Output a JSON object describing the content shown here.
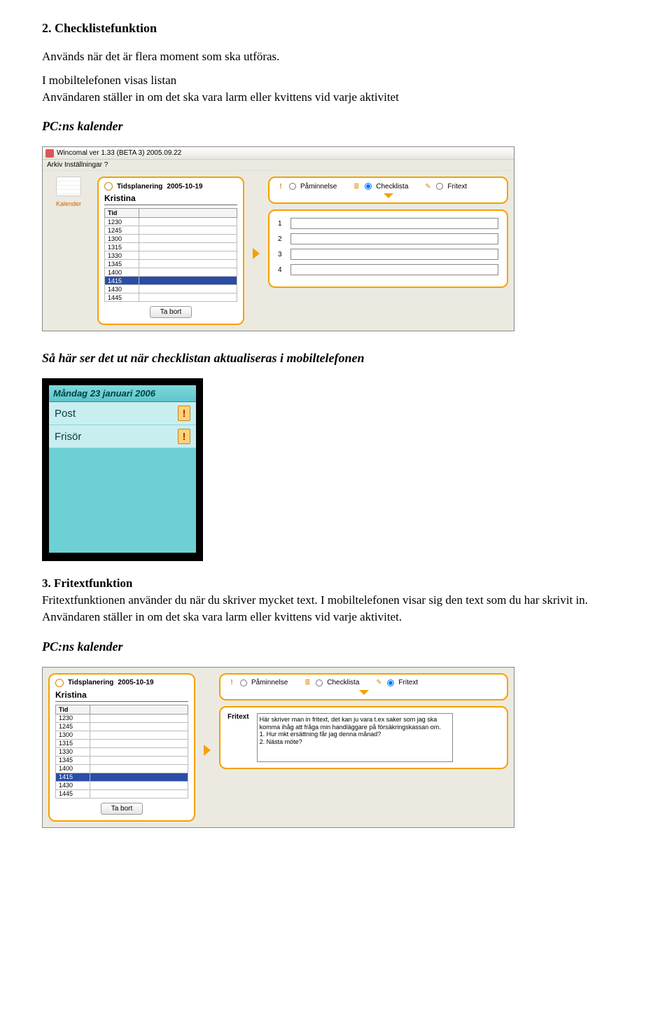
{
  "section2": {
    "heading": "2. Checklistefunktion",
    "intro": "Används när det är flera moment som ska utföras.",
    "desc": "I mobiltelefonen visas listan\nAnvändaren ställer in om det ska vara larm eller kvittens vid varje aktivitet",
    "pc_heading": "PC:ns kalender"
  },
  "app1": {
    "title": "Wincomal ver 1.33 (BETA 3) 2005.09.22",
    "menu": "Arkiv  Inställningar  ?",
    "nav_label": "Kalender",
    "plan_label": "Tidsplanering",
    "plan_date": "2005-10-19",
    "user": "Kristina",
    "col1": "Tid",
    "times": [
      "1230",
      "1245",
      "1300",
      "1315",
      "1330",
      "1345",
      "1400",
      "1415",
      "1430",
      "1445"
    ],
    "selected_time": "1415",
    "remove_btn": "Ta bort",
    "type_paminnelse": "Påminnelse",
    "type_checklista": "Checklista",
    "type_fritext": "Fritext",
    "type_selected": "Checklista",
    "field_nums": [
      "1",
      "2",
      "3",
      "4"
    ]
  },
  "mobile_heading": "Så här ser det ut när checklistan aktualiseras i mobiltelefonen",
  "phone": {
    "header": "Måndag 23 januari 2006",
    "rows": [
      "Post",
      "Frisör"
    ]
  },
  "section3": {
    "heading": "3. Fritextfunktion",
    "body": "Fritextfunktionen använder du när du skriver mycket text. I mobiltelefonen visar sig den text som du har skrivit in. Användaren ställer in om det ska vara larm eller kvittens vid varje aktivitet.",
    "pc_heading": "PC:ns kalender"
  },
  "app2": {
    "plan_label": "Tidsplanering",
    "plan_date": "2005-10-19",
    "user": "Kristina",
    "col1": "Tid",
    "times": [
      "1230",
      "1245",
      "1300",
      "1315",
      "1330",
      "1345",
      "1400",
      "1415",
      "1430",
      "1445"
    ],
    "selected_time": "1415",
    "remove_btn": "Ta bort",
    "type_paminnelse": "Påminnelse",
    "type_checklista": "Checklista",
    "type_fritext": "Fritext",
    "type_selected": "Fritext",
    "fritext_label": "Fritext",
    "fritext_value": "Här skriver man in fritext, det kan ju vara t.ex saker som jag ska komma ihåg att fråga min handläggare på försäkringskassan om.\n1. Hur mkt ersättning får jag denna månad?\n2. Nästa möte?"
  }
}
